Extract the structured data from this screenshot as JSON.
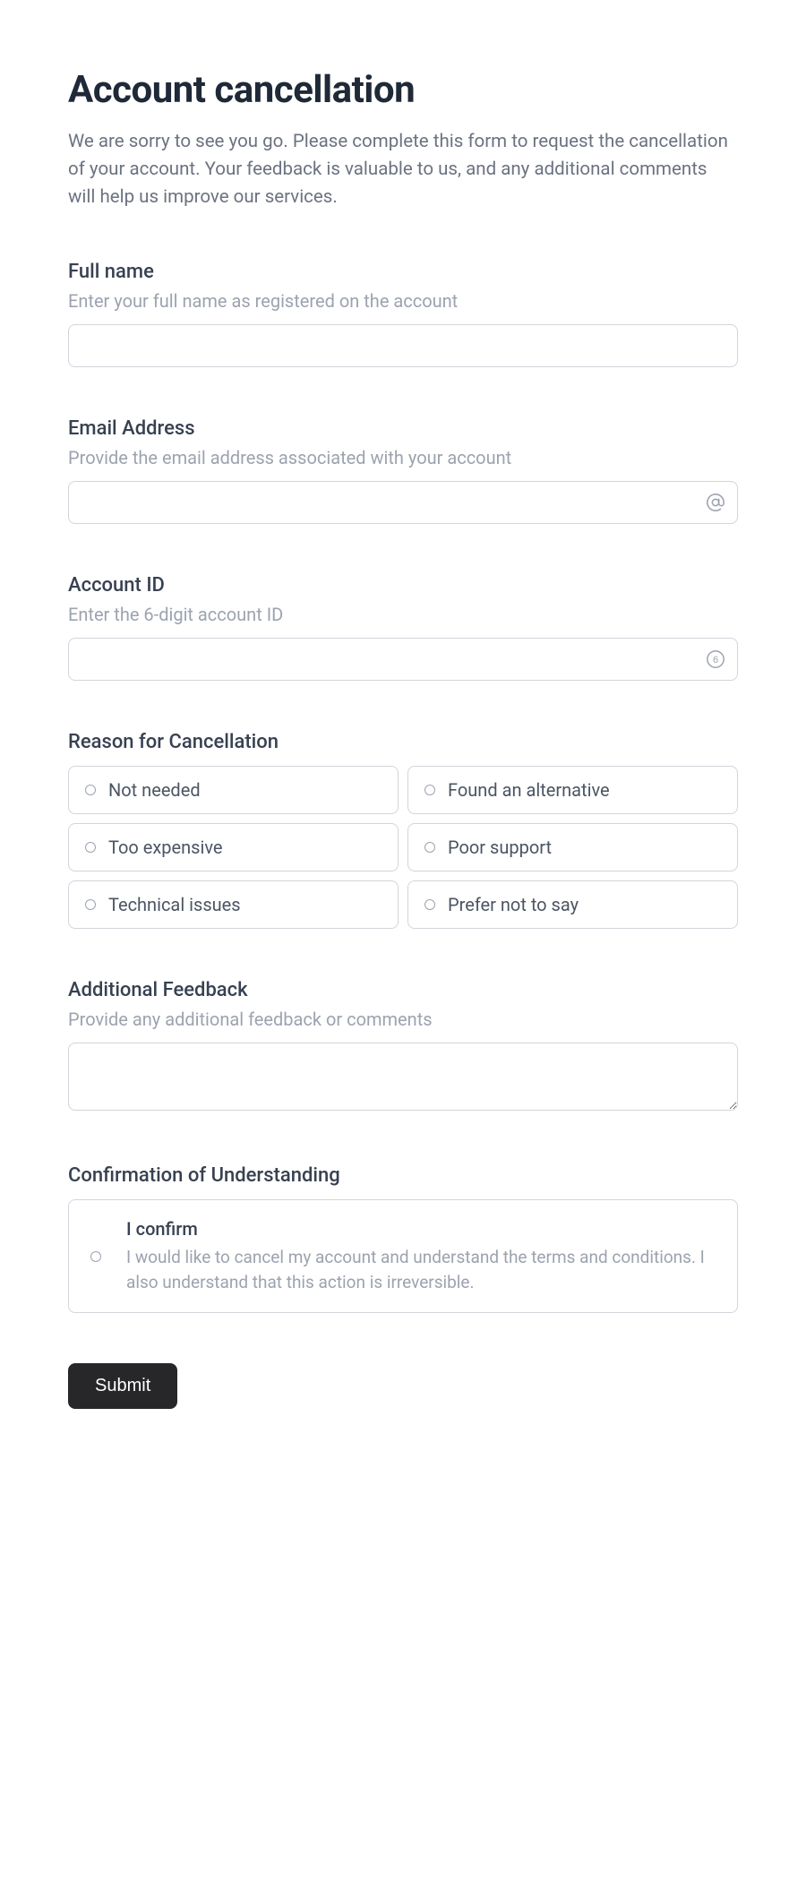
{
  "header": {
    "title": "Account cancellation",
    "intro": "We are sorry to see you go. Please complete this form to request the cancellation of your account. Your feedback is valuable to us, and any additional comments will help us improve our services."
  },
  "fields": {
    "full_name": {
      "label": "Full name",
      "help": "Enter your full name as registered on the account",
      "value": ""
    },
    "email": {
      "label": "Email Address",
      "help": "Provide the email address associated with your account",
      "value": ""
    },
    "account_id": {
      "label": "Account ID",
      "help": "Enter the 6-digit account ID",
      "value": ""
    },
    "reason": {
      "label": "Reason for Cancellation",
      "options": [
        "Not needed",
        "Found an alternative",
        "Too expensive",
        "Poor support",
        "Technical issues",
        "Prefer not to say"
      ]
    },
    "feedback": {
      "label": "Additional Feedback",
      "help": "Provide any additional feedback or comments",
      "value": ""
    },
    "confirm": {
      "label": "Confirmation of Understanding",
      "title": "I confirm",
      "description": "I would like to cancel my account and understand the terms and conditions. I also understand that this action is irreversible."
    }
  },
  "submit": {
    "label": "Submit"
  }
}
